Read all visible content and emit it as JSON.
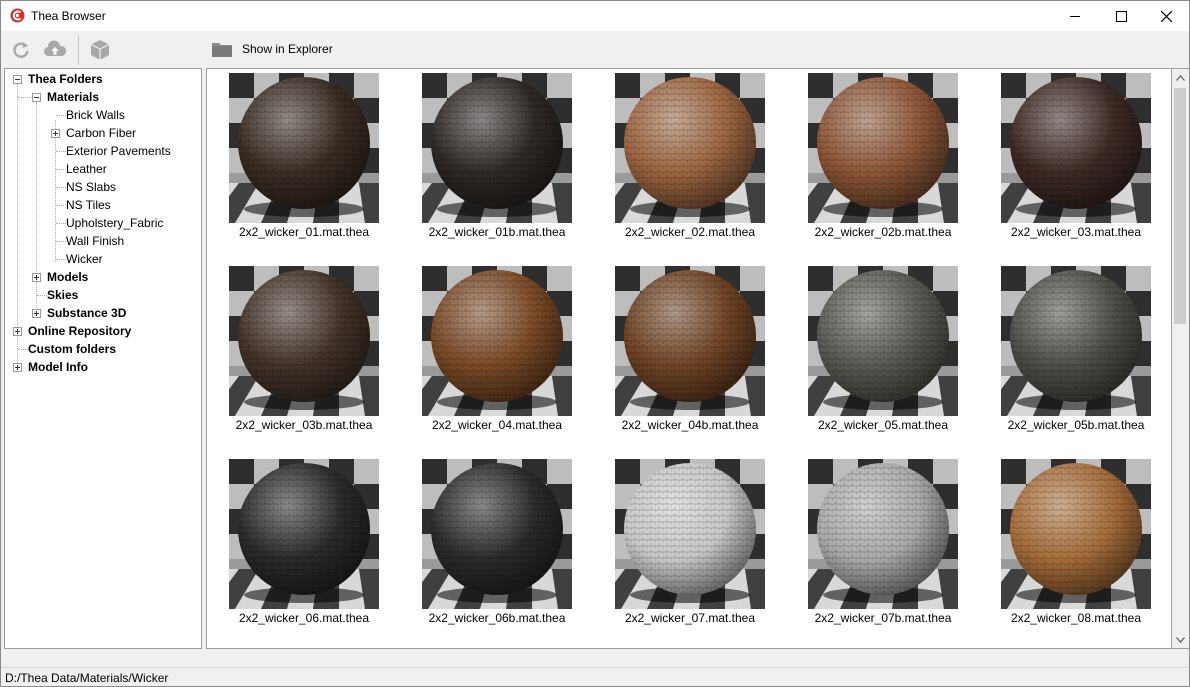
{
  "window": {
    "title": "Thea Browser",
    "accent_color": "#d32f2f"
  },
  "toolbar": {
    "refresh_icon": "refresh-icon",
    "upload_icon": "cloud-upload-icon",
    "model_icon": "cube-icon",
    "show_in_explorer_label": "Show in Explorer"
  },
  "tree": {
    "thea_folders": "Thea Folders",
    "materials": "Materials",
    "items": [
      "Brick Walls",
      "Carbon Fiber",
      "Exterior Pavements",
      "Leather",
      "NS Slabs",
      "NS Tiles",
      "Upholstery_Fabric",
      "Wall Finish",
      "Wicker"
    ],
    "models": "Models",
    "skies": "Skies",
    "substance": "Substance 3D",
    "online_repository": "Online Repository",
    "custom_folders": "Custom folders",
    "model_info": "Model Info",
    "selected": "Wicker"
  },
  "materials": [
    {
      "name": "2x2_wicker_01.mat.thea",
      "color": "#3b2d24"
    },
    {
      "name": "2x2_wicker_01b.mat.thea",
      "color": "#2f2926"
    },
    {
      "name": "2x2_wicker_02.mat.thea",
      "color": "#9b6540"
    },
    {
      "name": "2x2_wicker_02b.mat.thea",
      "color": "#8d5637"
    },
    {
      "name": "2x2_wicker_03.mat.thea",
      "color": "#3e2a24"
    },
    {
      "name": "2x2_wicker_03b.mat.thea",
      "color": "#433329"
    },
    {
      "name": "2x2_wicker_04.mat.thea",
      "color": "#7a4a26"
    },
    {
      "name": "2x2_wicker_04b.mat.thea",
      "color": "#704425"
    },
    {
      "name": "2x2_wicker_05.mat.thea",
      "color": "#5a5a52"
    },
    {
      "name": "2x2_wicker_05b.mat.thea",
      "color": "#4f4f49"
    },
    {
      "name": "2x2_wicker_06.mat.thea",
      "color": "#2a2a2a"
    },
    {
      "name": "2x2_wicker_06b.mat.thea",
      "color": "#2b2b2b"
    },
    {
      "name": "2x2_wicker_07.mat.thea",
      "color": "#c8c8c8"
    },
    {
      "name": "2x2_wicker_07b.mat.thea",
      "color": "#aaaaaa"
    },
    {
      "name": "2x2_wicker_08.mat.thea",
      "color": "#a66d3a"
    }
  ],
  "status": {
    "path": "D:/Thea Data/Materials/Wicker"
  }
}
